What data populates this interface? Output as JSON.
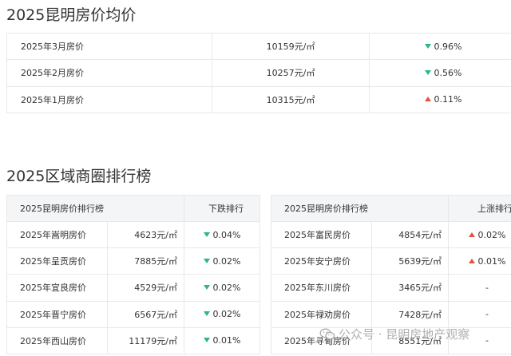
{
  "section1": {
    "title": "2025昆明房价均价",
    "rows": [
      {
        "label": "2025年3月房价",
        "price": "10159元/㎡",
        "direction": "down",
        "change": "0.96%"
      },
      {
        "label": "2025年2月房价",
        "price": "10257元/㎡",
        "direction": "down",
        "change": "0.56%"
      },
      {
        "label": "2025年1月房价",
        "price": "10315元/㎡",
        "direction": "up",
        "change": "0.11%"
      }
    ]
  },
  "section2": {
    "title": "2025区域商圈排行榜",
    "left_table": {
      "header_name": "2025昆明房价排行榜",
      "header_rank": "下跌排行",
      "rows": [
        {
          "label": "2025年嵩明房价",
          "price": "4623元/㎡",
          "direction": "down",
          "change": "0.04%"
        },
        {
          "label": "2025年呈贡房价",
          "price": "7885元/㎡",
          "direction": "down",
          "change": "0.02%"
        },
        {
          "label": "2025年宜良房价",
          "price": "4529元/㎡",
          "direction": "down",
          "change": "0.02%"
        },
        {
          "label": "2025年晋宁房价",
          "price": "6567元/㎡",
          "direction": "down",
          "change": "0.02%"
        },
        {
          "label": "2025年西山房价",
          "price": "11179元/㎡",
          "direction": "down",
          "change": "0.01%"
        }
      ]
    },
    "right_table": {
      "header_name": "2025昆明房价排行榜",
      "header_rank": "上涨排行",
      "rows": [
        {
          "label": "2025年富民房价",
          "price": "4854元/㎡",
          "direction": "up",
          "change": "0.02%"
        },
        {
          "label": "2025年安宁房价",
          "price": "5639元/㎡",
          "direction": "up",
          "change": "0.01%"
        },
        {
          "label": "2025年东川房价",
          "price": "3465元/㎡",
          "direction": "none",
          "change": "-"
        },
        {
          "label": "2025年禄劝房价",
          "price": "7428元/㎡",
          "direction": "none",
          "change": "-"
        },
        {
          "label": "2025年寻甸房价",
          "price": "8551元/㎡",
          "direction": "none",
          "change": "-"
        }
      ]
    }
  },
  "watermark": {
    "text": "公众号 · 昆明房地产观察",
    "icon": "wechat-icon"
  },
  "colors": {
    "down": "#2db58d",
    "up": "#e0543e",
    "header_bg": "#f4f5f7",
    "border": "#e8e8e8"
  }
}
